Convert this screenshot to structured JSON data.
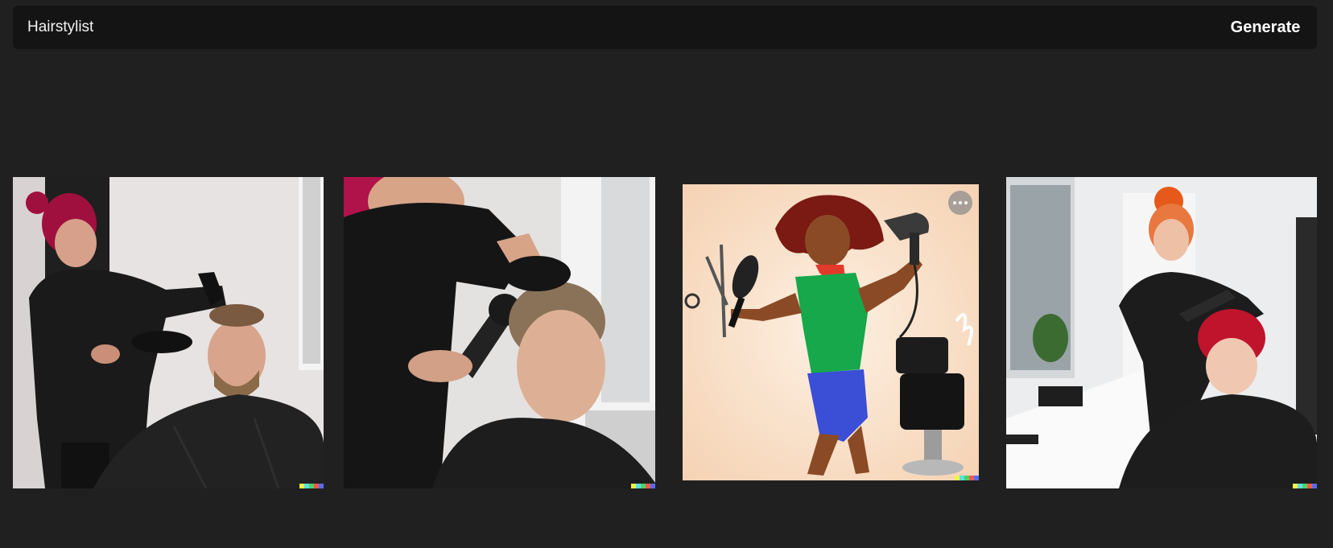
{
  "prompt": {
    "value": "Hairstylist"
  },
  "toolbar": {
    "generate_label": "Generate"
  },
  "gallery": {
    "images": [
      {
        "kind": "photo",
        "subject": "stylist with magenta bun blow-drying a man's hair"
      },
      {
        "kind": "photo",
        "subject": "stylist blow-drying a young man's hair"
      },
      {
        "kind": "illustration",
        "subject": "cartoon hairstylist with scissors, brush and dryer"
      },
      {
        "kind": "photo",
        "subject": "stylist with orange bun styling a woman's red hair"
      }
    ],
    "more_icon": "more-horizontal-icon"
  },
  "colors": {
    "page_bg": "#202020",
    "bar_bg": "#141414",
    "text": "#f2f2f2",
    "watermark": [
      "#f5f04a",
      "#5ce0e0",
      "#4ad36a",
      "#f05a4a",
      "#5a6af0"
    ]
  }
}
